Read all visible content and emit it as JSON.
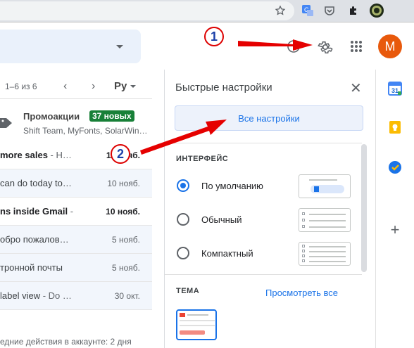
{
  "quick_settings": {
    "title": "Быстрые настройки",
    "all_settings_button": "Все настройки",
    "interface_label": "ИНТЕРФЕЙС",
    "density_options": [
      {
        "label": "По умолчанию",
        "selected": true
      },
      {
        "label": "Обычный",
        "selected": false
      },
      {
        "label": "Компактный",
        "selected": false
      }
    ],
    "theme_label": "ТЕМА",
    "theme_view_all": "Просмотреть все",
    "close_icon": "close-icon"
  },
  "mail_list": {
    "pager": "1–6 из 6",
    "language_selector": "Ру",
    "promotions": {
      "title": "Промоакции",
      "badge": "37 новых",
      "senders": "Shift Team, MyFonts, SolarWin…"
    },
    "rows": [
      {
        "subject": "more sales",
        "snippet": " - H…",
        "date": "11 нояб.",
        "unread": true
      },
      {
        "subject": "can do today to…",
        "snippet": "",
        "date": "10 нояб.",
        "unread": false
      },
      {
        "subject": "ns inside Gmail",
        "snippet": " -",
        "date": "10 нояб.",
        "unread": true
      },
      {
        "subject": "обро пожалов…",
        "snippet": "",
        "date": "5 нояб.",
        "unread": false
      },
      {
        "subject": "тронной почты",
        "snippet": "",
        "date": "5 нояб.",
        "unread": false
      },
      {
        "subject": "label view",
        "snippet": " - Do …",
        "date": "30 окт.",
        "unread": false
      }
    ],
    "footer": "едние действия в аккаунте: 2 дня"
  },
  "header": {
    "avatar_letter": "M",
    "icons": [
      "help-icon",
      "settings-gear-icon",
      "apps-grid-icon"
    ]
  },
  "browser": {
    "icons": [
      "bookmark-star-icon",
      "translate-icon",
      "pocket-icon",
      "extensions-puzzle-icon",
      "profile-icon"
    ]
  },
  "annotations": {
    "step1": "1",
    "step2": "2"
  },
  "colors": {
    "accent_blue": "#1a73e8",
    "promo_badge": "#188038",
    "avatar": "#e8590c",
    "arrow_red": "#e50000"
  }
}
